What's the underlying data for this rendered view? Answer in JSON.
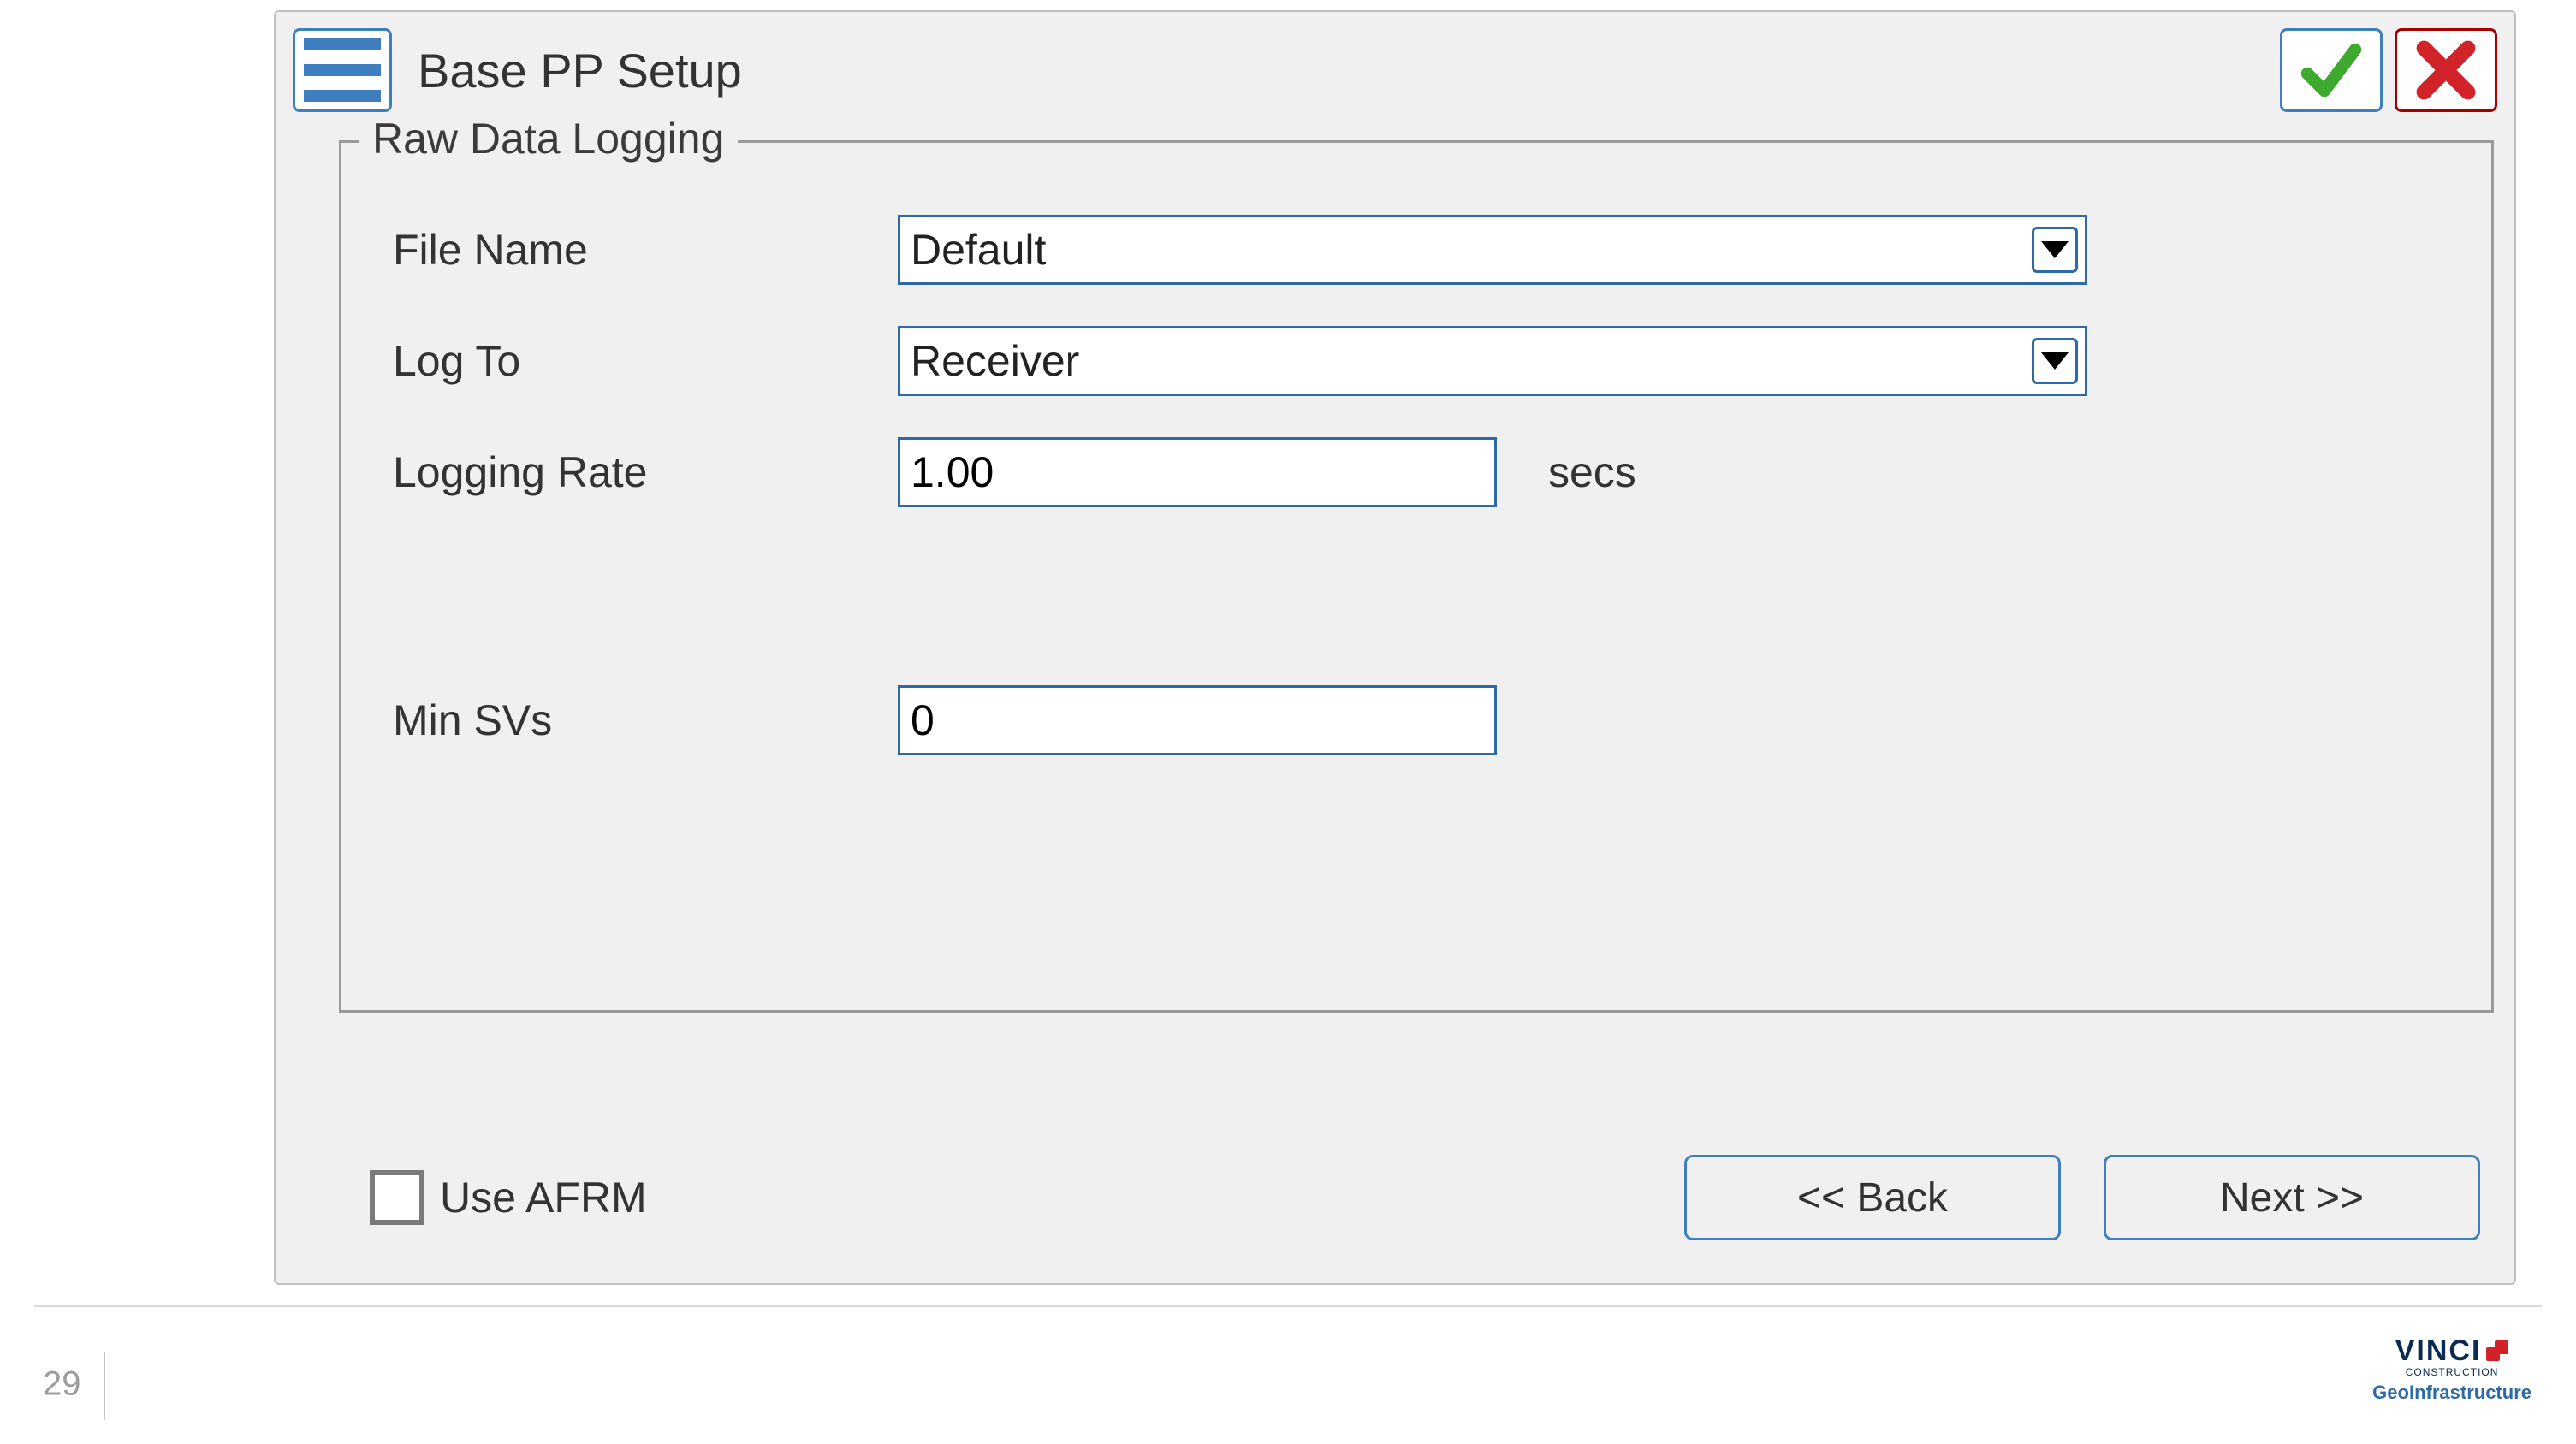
{
  "header": {
    "title": "Base PP Setup"
  },
  "group": {
    "legend": "Raw Data Logging",
    "file_name": {
      "label": "File Name",
      "value": "Default"
    },
    "log_to": {
      "label": "Log To",
      "value": "Receiver"
    },
    "logging_rate": {
      "label": "Logging Rate",
      "value": "1.00",
      "units": "secs"
    },
    "min_svs": {
      "label": "Min SVs",
      "value": "0"
    }
  },
  "footer": {
    "use_afrm_label": "Use AFRM",
    "use_afrm_checked": false,
    "back_label": "<< Back",
    "next_label": "Next >>"
  },
  "page": {
    "number": "29",
    "brand_word": "VINCI",
    "brand_sub1": "CONSTRUCTION",
    "brand_sub2": "GeoInfrastructure"
  }
}
